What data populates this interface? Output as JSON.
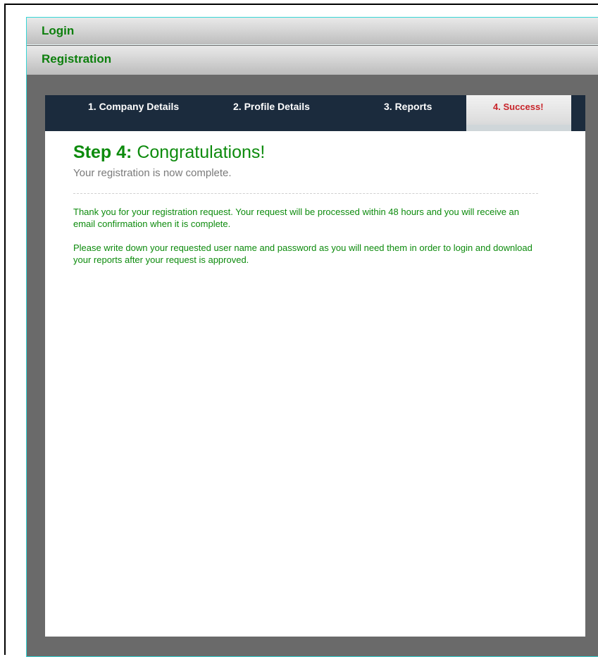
{
  "accordion": {
    "login_label": "Login",
    "registration_label": "Registration"
  },
  "wizard": {
    "steps": [
      {
        "label": "1. Company Details",
        "active": false
      },
      {
        "label": "2. Profile Details",
        "active": false
      },
      {
        "label": "3. Reports",
        "active": false
      },
      {
        "label": "4. Success!",
        "active": true
      }
    ],
    "title_step": "Step 4:",
    "title_text": "Congratulations!",
    "subtitle": "Your registration is now complete.",
    "paragraph_1": "Thank you for your registration request.  Your request will be processed within 48 hours and you will receive an email confirmation when it is complete.",
    "paragraph_2": "Please write down your requested user name and password as you will need them in order to login and download your reports after your request is approved."
  },
  "colors": {
    "accent_green": "#0d8b0d",
    "active_step_red": "#c8242a",
    "step_bar_navy": "#1b2b3d",
    "panel_gray": "#6a6a6a",
    "frame_cyan": "#36d6d6"
  }
}
